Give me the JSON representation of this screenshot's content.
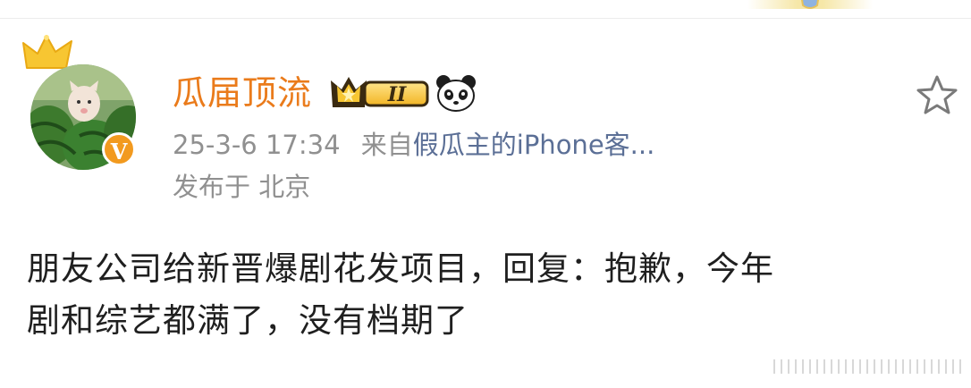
{
  "post": {
    "username": "瓜届顶流",
    "level_label": "II",
    "timestamp": "25-3-6 17:34",
    "source_prefix": "来自",
    "source": "假瓜主的iPhone客...",
    "location": "发布于 北京",
    "content_lines": [
      "朋友公司给新晋爆剧花发项目，回复：抱歉，今年",
      "剧和综艺都满了，没有档期了"
    ]
  },
  "icons": {
    "avatar_crown": "crown-icon",
    "verified_badge": "v-badge-icon",
    "level_badge": "crown-level-badge-icon",
    "panda": "panda-icon",
    "favorite": "star-outline-icon"
  },
  "colors": {
    "username": "#ea7b1b",
    "meta_text": "#909090",
    "source_link": "#5b6f96",
    "body_text": "#1f1f1f",
    "verified_badge": "#f29a1f"
  }
}
